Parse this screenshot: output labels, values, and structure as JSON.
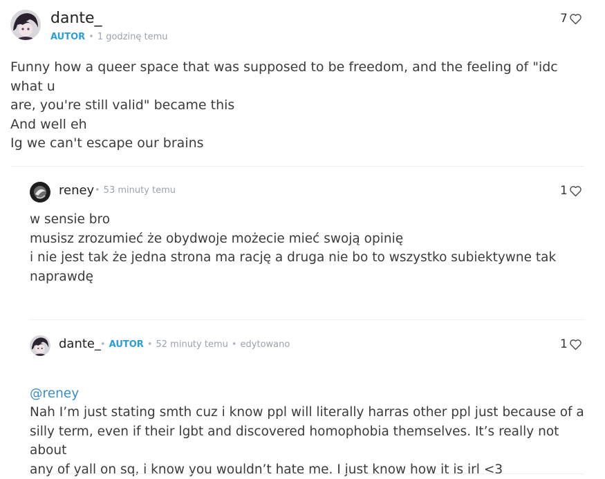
{
  "comment_main": {
    "author": "dante_",
    "badge": "AUTOR",
    "time": "1 godzinę temu",
    "likes": "7",
    "text": "Funny how a queer space that was supposed to be freedom, and the feeling of \"idc what u\nare, you're still valid\" became this\nAnd well eh\nIg we can't escape our brains"
  },
  "reply_1": {
    "author": "reney",
    "time": "53 minuty temu",
    "likes": "1",
    "text": "w sensie bro\nmusisz zrozumieć że obydwoje możecie mieć swoją opinię\ni nie jest tak że jedna strona ma rację a druga nie bo to wszystko subiektywne tak\nnaprawdę"
  },
  "reply_2": {
    "author": "dante_",
    "badge": "AUTOR",
    "time": "52 minuty temu",
    "edited": "edytowano",
    "likes": "1",
    "mention": "@reney",
    "text": "Nah I’m just stating smth cuz i know ppl will literally harras other ppl just because of a\nsilly term, even if their lgbt and discovered homophobia themselves. It’s really not about\nany of yall on sq, i know you wouldn’t hate me. I just know how it is irl <3"
  },
  "colors": {
    "accent": "#2a9fd6",
    "meta": "#9aa3ad",
    "mention": "#3a8fc7"
  }
}
